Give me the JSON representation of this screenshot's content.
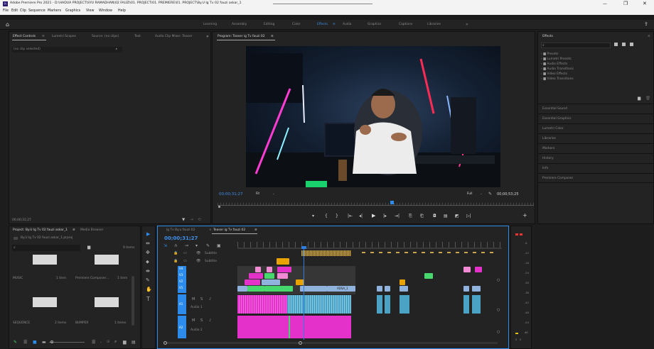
{
  "window": {
    "title": "Adobe Premiere Pro 2021 - D:\\HADUA PROJECT\\SYU RAMADHAN\\02 FAUZI\\01. PROJECT\\01. PREMIERE\\01. PROJECT\\By.U Ig Tv 02 fauzi askar_1",
    "app_icon": "Pr",
    "minimize": "—",
    "restore": "❐",
    "close": "✕"
  },
  "menu": [
    "File",
    "Edit",
    "Clip",
    "Sequence",
    "Markers",
    "Graphics",
    "View",
    "Window",
    "Help"
  ],
  "workspaces": {
    "tabs": [
      "Learning",
      "Assembly",
      "Editing",
      "Color",
      "Effects",
      "Audio",
      "Graphics",
      "Captions",
      "Libraries"
    ],
    "active": "Effects",
    "more": "»"
  },
  "source_panel": {
    "tabs": [
      "Effect Controls",
      "Lumetri Scopes",
      "Source: (no clips)",
      "Text",
      "Audio Clip Mixer: Teaser"
    ],
    "active_tab": "Effect Controls",
    "menu_glyph": "≡",
    "clip_dropdown": "(no clip selected)",
    "timecode": "00;00;31;27"
  },
  "program": {
    "tab": "Program: Teaser ig Tv fauzi 02",
    "menu_glyph": "≡",
    "timecode_in": "00;00;31;27",
    "fit": "Fit",
    "quality": "Full",
    "timecode_out": "00;00;53;25",
    "controls": [
      "▾",
      "{",
      "}",
      "|⇤",
      "◂|",
      "▶",
      "|▸",
      "⇥|",
      "⎘",
      "⎗",
      "◘",
      "▤",
      "◩",
      "▷|",
      "+"
    ]
  },
  "effects_panel": {
    "title": "Effects",
    "menu_glyph": "≡",
    "search_placeholder": "",
    "tree": [
      "Presets",
      "Lumetri Presets",
      "Audio Effects",
      "Audio Transitions",
      "Video Effects",
      "Video Transitions"
    ],
    "sections": [
      "Essential Sound",
      "Essential Graphics",
      "Lumetri Color",
      "Libraries",
      "Markers",
      "History",
      "Info",
      "Premiere Composer"
    ]
  },
  "project_panel": {
    "tabs": [
      "Project: By.U Ig Tv 02 fauzi askar_1",
      "Media Browser"
    ],
    "project_file": "By.U Ig Tv 02 fauzi askar_1.prproj",
    "items_count": "9 items",
    "bins": [
      {
        "name": "MUSIC",
        "count": "1 item"
      },
      {
        "name": "Premiere Composer...",
        "count": "1 item"
      },
      {
        "name": "SEQUENCE",
        "count": "2 items"
      },
      {
        "name": "BUMPER",
        "count": "1 items"
      }
    ]
  },
  "timeline": {
    "tabs": [
      "Ig Tv By.u fauzi 02",
      "Teaser ig Tv fauzi 02"
    ],
    "active_tab": "Teaser ig Tv fauzi 02",
    "timecode": "00;00;31;27",
    "tracks": [
      {
        "id": "V6",
        "label": "Subtitle"
      },
      {
        "id": "V5",
        "label": "Subtitle"
      },
      {
        "id": "V4",
        "label": ""
      },
      {
        "id": "V3",
        "label": ""
      },
      {
        "id": "V2",
        "label": ""
      },
      {
        "id": "V1",
        "label": ""
      },
      {
        "id": "A1",
        "label": "Audio 1"
      },
      {
        "id": "A2",
        "label": "Audio 2"
      }
    ],
    "clip_label": "ADSA_1"
  },
  "tools": [
    "▶",
    "⇹",
    "✥",
    "⬥",
    "⇼",
    "✎",
    "✋",
    "T"
  ],
  "meter_labels": [
    "-6",
    "-12",
    "-18",
    "-24",
    "-30",
    "-36",
    "-42",
    "-48",
    "-54",
    "dB"
  ],
  "meter_solo": [
    "S",
    "S"
  ],
  "colors": {
    "accent_blue": "#2d8ceb",
    "playhead": "#2e7de0",
    "clip_magenta": "#e331c9",
    "clip_green": "#46d86d",
    "clip_pink": "#f28ad6",
    "clip_blue": "#8fb3dd",
    "clip_orange": "#e8a300",
    "audio_teal": "#4aa3c5"
  }
}
